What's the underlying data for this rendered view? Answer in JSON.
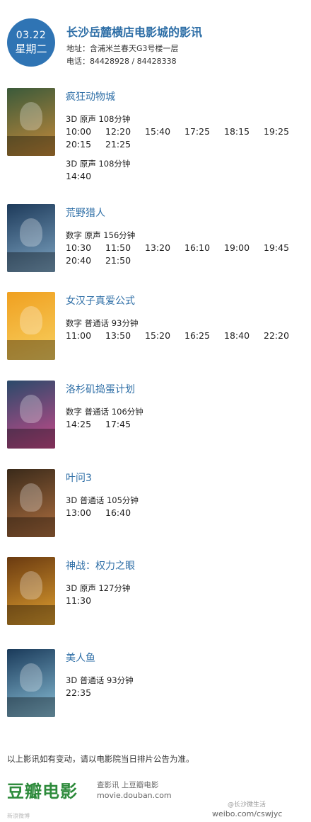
{
  "header": {
    "date": "03.22",
    "weekday": "星期二",
    "cinema_name": "长沙岳麓横店电影城的影讯",
    "address": "地址：含浦米兰春天G3号楼一层",
    "phone": "电话：84428928 / 84428338"
  },
  "movies": [
    {
      "title": "疯狂动物城",
      "poster_colors": [
        "#3a5a3a",
        "#c78a3a"
      ],
      "sessions": [
        {
          "format": "3D  原声  108分钟",
          "times": [
            "10:00",
            "12:20",
            "15:40",
            "17:25",
            "18:15",
            "19:25",
            "20:15",
            "21:25"
          ]
        },
        {
          "format": "3D  原声  108分钟",
          "times": [
            "14:40"
          ]
        }
      ]
    },
    {
      "title": "荒野猎人",
      "poster_colors": [
        "#1d3a5a",
        "#7fa6c4"
      ],
      "sessions": [
        {
          "format": "数字  原声  156分钟",
          "times": [
            "10:30",
            "11:50",
            "13:20",
            "16:10",
            "19:00",
            "19:45",
            "20:40",
            "21:50"
          ]
        }
      ]
    },
    {
      "title": "女汉子真爱公式",
      "poster_colors": [
        "#f0a020",
        "#f7d060"
      ],
      "sessions": [
        {
          "format": "数字  普通话  93分钟",
          "times": [
            "11:00",
            "13:50",
            "15:20",
            "16:25",
            "18:40",
            "22:20"
          ]
        }
      ]
    },
    {
      "title": "洛杉矶捣蛋计划",
      "poster_colors": [
        "#2a4a6a",
        "#c84a8a"
      ],
      "sessions": [
        {
          "format": "数字  普通话  106分钟",
          "times": [
            "14:25",
            "17:45"
          ]
        }
      ]
    },
    {
      "title": "叶问3",
      "poster_colors": [
        "#3a2a1a",
        "#b07040"
      ],
      "sessions": [
        {
          "format": "3D  普通话  105分钟",
          "times": [
            "13:00",
            "16:40"
          ]
        }
      ]
    },
    {
      "title": "神战：权力之眼",
      "poster_colors": [
        "#6a3a10",
        "#e0a030"
      ],
      "sessions": [
        {
          "format": "3D  原声  127分钟",
          "times": [
            "11:30"
          ]
        }
      ]
    },
    {
      "title": "美人鱼",
      "poster_colors": [
        "#1a3a5a",
        "#8ac0d8"
      ],
      "sessions": [
        {
          "format": "3D  普通话  93分钟",
          "times": [
            "22:35"
          ]
        }
      ]
    }
  ],
  "footer": {
    "notice": "以上影讯如有变动，请以电影院当日排片公告为准。",
    "logo": "豆瓣电影",
    "slogan": "查影讯  上豆瓣电影",
    "site": "movie.douban.com",
    "watermark_left": "新浪微博",
    "watermark_right_1": "@长沙微生活",
    "watermark_right_2": "weibo.com/cswjyc"
  },
  "theme": {
    "accent": "#2f6fa7",
    "badge": "#2f74b4",
    "logo": "#2e8b3c"
  }
}
